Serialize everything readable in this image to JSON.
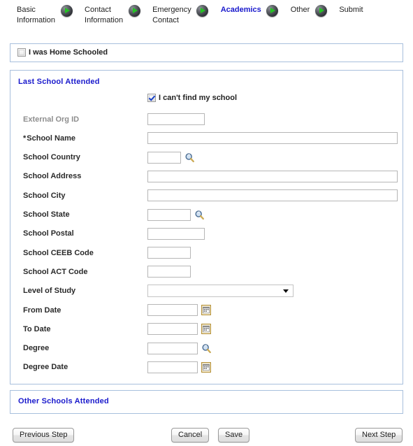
{
  "stepnav": {
    "steps": [
      {
        "label": "Basic\nInformation",
        "current": false
      },
      {
        "label": "Contact\nInformation",
        "current": false
      },
      {
        "label": "Emergency\nContact",
        "current": false
      },
      {
        "label": "Academics",
        "current": true
      },
      {
        "label": "Other",
        "current": false
      },
      {
        "label": "Submit",
        "current": false
      }
    ],
    "separator_icon": "green-play-ball-icon"
  },
  "home_schooled": {
    "checkbox_label": "I was Home Schooled",
    "checked": false
  },
  "last_school": {
    "title": "Last School Attended",
    "cant_find": {
      "label": "I can't find my school",
      "checked": true
    },
    "fields": [
      {
        "label": "External Org ID",
        "value": "",
        "control": "text",
        "width": "w-med",
        "disabled": true,
        "required": false,
        "icon": ""
      },
      {
        "label": "School Name",
        "value": "",
        "control": "text",
        "width": "w-wide",
        "disabled": false,
        "required": true,
        "icon": ""
      },
      {
        "label": "School Country",
        "value": "",
        "control": "text",
        "width": "w-small",
        "disabled": false,
        "required": false,
        "icon": "lookup-icon"
      },
      {
        "label": "School Address",
        "value": "",
        "control": "text",
        "width": "w-wide",
        "disabled": false,
        "required": false,
        "icon": ""
      },
      {
        "label": "School City",
        "value": "",
        "control": "text",
        "width": "w-wide",
        "disabled": false,
        "required": false,
        "icon": ""
      },
      {
        "label": "School State",
        "value": "",
        "control": "text",
        "width": "w-mid",
        "disabled": false,
        "required": false,
        "icon": "lookup-icon"
      },
      {
        "label": "School Postal",
        "value": "",
        "control": "text",
        "width": "w-med",
        "disabled": false,
        "required": false,
        "icon": ""
      },
      {
        "label": "School CEEB Code",
        "value": "",
        "control": "text",
        "width": "w-mid",
        "disabled": false,
        "required": false,
        "icon": ""
      },
      {
        "label": "School ACT Code",
        "value": "",
        "control": "text",
        "width": "w-mid",
        "disabled": false,
        "required": false,
        "icon": ""
      },
      {
        "label": "Level of Study",
        "value": "",
        "control": "select",
        "width": "",
        "disabled": false,
        "required": false,
        "icon": "chevron-down-icon",
        "options": [
          ""
        ]
      },
      {
        "label": "From Date",
        "value": "",
        "control": "text",
        "width": "w-date",
        "disabled": false,
        "required": false,
        "icon": "calendar-icon"
      },
      {
        "label": "To Date",
        "value": "",
        "control": "text",
        "width": "w-date",
        "disabled": false,
        "required": false,
        "icon": "calendar-icon"
      },
      {
        "label": "Degree",
        "value": "",
        "control": "text",
        "width": "w-date",
        "disabled": false,
        "required": false,
        "icon": "lookup-icon"
      },
      {
        "label": "Degree Date",
        "value": "",
        "control": "text",
        "width": "w-date",
        "disabled": false,
        "required": false,
        "icon": "calendar-icon"
      }
    ]
  },
  "other_schools": {
    "title": "Other Schools Attended"
  },
  "buttons": {
    "previous": "Previous Step",
    "cancel": "Cancel",
    "save": "Save",
    "next": "Next Step"
  },
  "colors": {
    "panel_border": "#a8c0dd",
    "heading_blue": "#1919cc",
    "label_dark": "#2a2a2a",
    "label_disabled": "#8e8e8e",
    "ball_green": "#24c224"
  }
}
